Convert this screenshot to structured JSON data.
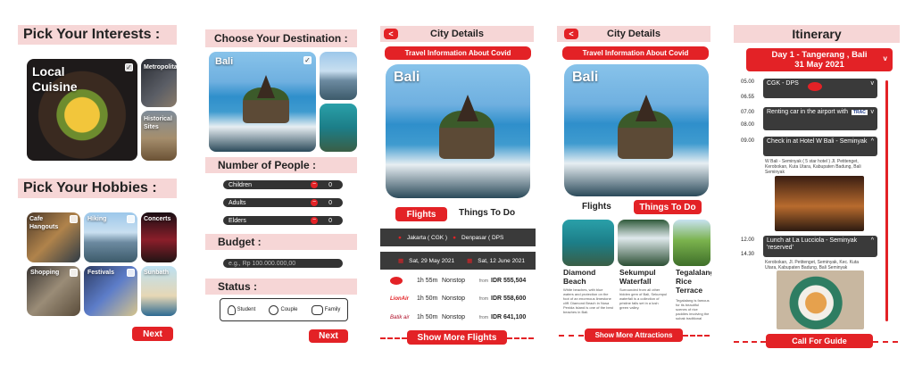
{
  "screen1": {
    "interests_title": "Pick Your Interests :",
    "interests": [
      {
        "label": "Local Cuisine",
        "checked": true
      },
      {
        "label": "Metropolitan City"
      },
      {
        "label": "Historical Sites"
      }
    ],
    "hobbies_title": "Pick Your Hobbies :",
    "hobbies": [
      {
        "label": "Cafe Hangouts"
      },
      {
        "label": "Hiking"
      },
      {
        "label": "Concerts"
      },
      {
        "label": "Shopping"
      },
      {
        "label": "Festivals"
      },
      {
        "label": "Sunbath"
      }
    ],
    "next": "Next"
  },
  "screen2": {
    "title": "Choose Your Destination :",
    "destination": "Bali",
    "people_title": "Number of People :",
    "people": [
      {
        "label": "Children",
        "count": "0"
      },
      {
        "label": "Adults",
        "count": "0"
      },
      {
        "label": "Elders",
        "count": "0"
      }
    ],
    "budget_title": "Budget :",
    "budget_placeholder": "e.g., Rp 100.000.000,00",
    "status_title": "Status :",
    "status": [
      "Student",
      "Couple",
      "Family"
    ],
    "next": "Next"
  },
  "screen3": {
    "back": "<",
    "title": "City Details",
    "covid": "Travel Information About Covid",
    "city": "Bali",
    "tab_flights": "Flights",
    "tab_things": "Things To Do",
    "from": "Jakarta ( CGK )",
    "to": "Denpasar ( DPS",
    "date_from": "Sat, 29 May 2021",
    "date_to": "Sat, 12 June 2021",
    "flights": [
      {
        "airline": "AirAsia",
        "duration": "1h 55m",
        "type": "Nonstop",
        "from": "from",
        "price": "IDR 555,504"
      },
      {
        "airline": "Lion Air",
        "duration": "1h 50m",
        "type": "Nonstop",
        "from": "from",
        "price": "IDR 558,600"
      },
      {
        "airline": "Batik Air",
        "duration": "1h 50m",
        "type": "Nonstop",
        "from": "from",
        "price": "IDR 641,100"
      }
    ],
    "more": "Show More Flights"
  },
  "screen4": {
    "back": "<",
    "title": "City Details",
    "covid": "Travel Information About Covid",
    "city": "Bali",
    "tab_flights": "Flights",
    "tab_things": "Things To Do",
    "attractions": [
      {
        "name": "Diamond Beach",
        "text": "White beaches, with blue waters and protection on the foot of an enormous limestone cliff. Diamond Beach in Nusa Penida Island is one of the best beaches in Bali."
      },
      {
        "name": "Sekumpul Waterfall",
        "text": "Surrounded from all other hidden gem of Bali, Sekumpul waterfall is a collection of pristine falls set in a lush green valley."
      },
      {
        "name": "Tegalalang Rice Terrace",
        "text": "Tegalalang is famous for its beautiful scenes of rice paddies involving the subak traditional Balinese irrigation system."
      }
    ],
    "more": "Show More Attractions"
  },
  "screen5": {
    "title": "Itinerary",
    "day": "Day 1 - Tangerang , Bali",
    "date": "31 May 2021",
    "items": [
      {
        "time1": "05.00",
        "time2": "06.55",
        "label": "CGK - DPS",
        "logo": "AirAsia"
      },
      {
        "time1": "07.00",
        "time2": "08.00",
        "label": "Renting car in the airport with",
        "logo": "TRAC"
      },
      {
        "time1": "09.00",
        "label": "Check in at Hotel W Bali - Seminyak",
        "desc": "W Bali - Seminyak ( 5 star hotel ) Jl. Petitenget, Kerobokan, Kuta Utara, Kabupaten Badung, Bali Seminyak"
      },
      {
        "time1": "12.00",
        "time2": "14.30",
        "label": "Lunch at La Lucciola - Seminyak 'reserved'",
        "desc": "Kerobokan, Jl. Petitenget, Seminyak, Kec. Kuta Utara, Kabupaten Badung, Bali Seminyak"
      }
    ],
    "cta": "Call For Guide"
  },
  "colors": {
    "accent": "#e32226",
    "pink": "#f6d6d6",
    "dark": "#333333"
  }
}
